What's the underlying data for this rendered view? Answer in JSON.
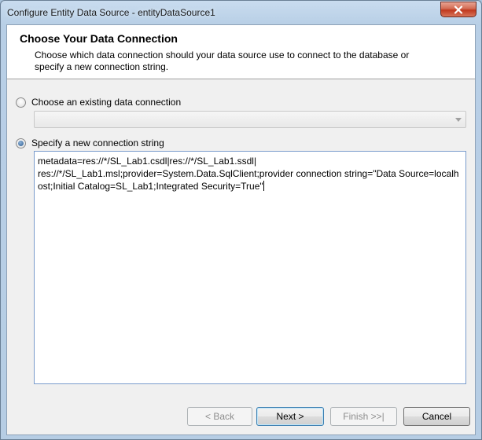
{
  "window": {
    "title": "Configure Entity Data Source - entityDataSource1"
  },
  "header": {
    "title": "Choose Your Data Connection",
    "description": "Choose which data connection should your data source use to connect to the database or specify a new connection string."
  },
  "options": {
    "existing_label": "Choose an existing data connection",
    "existing_selected": false,
    "existing_value": "",
    "new_label": "Specify a new connection string",
    "new_selected": true
  },
  "connection_string": "metadata=res://*/SL_Lab1.csdl|res://*/SL_Lab1.ssdl|\nres://*/SL_Lab1.msl;provider=System.Data.SqlClient;provider connection string=\"Data Source=localhost;Initial Catalog=SL_Lab1;Integrated Security=True\"",
  "buttons": {
    "back": "< Back",
    "next": "Next >",
    "finish": "Finish >>|",
    "cancel": "Cancel"
  },
  "icons": {
    "close": "close-icon",
    "dropdown": "chevron-down-icon"
  }
}
